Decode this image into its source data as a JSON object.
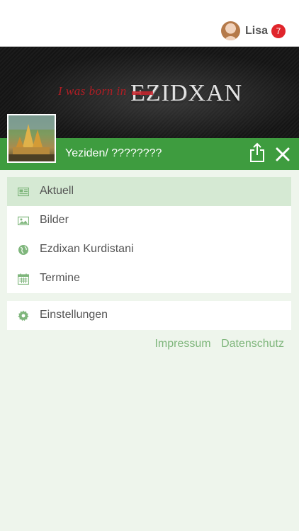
{
  "header": {
    "user_name": "Lisa",
    "notification_count": "7"
  },
  "banner": {
    "slogan": "I was born in",
    "brand": "EZIDXAN"
  },
  "titlebar": {
    "title": "Yeziden/ ????????"
  },
  "menu": {
    "items": [
      {
        "label": "Aktuell",
        "icon": "newspaper-icon",
        "active": true
      },
      {
        "label": "Bilder",
        "icon": "image-icon",
        "active": false
      },
      {
        "label": "Ezdixan Kurdistani",
        "icon": "globe-icon",
        "active": false
      },
      {
        "label": "Termine",
        "icon": "calendar-icon",
        "active": false
      }
    ],
    "settings": {
      "label": "Einstellungen",
      "icon": "gear-icon"
    }
  },
  "footer": {
    "impressum": "Impressum",
    "datenschutz": "Datenschutz"
  },
  "colors": {
    "accent_green": "#3e9c3f",
    "active_item": "#d5e9d3",
    "background": "#eef5ec",
    "badge_red": "#e0252b",
    "link_green": "#7fb67c"
  }
}
